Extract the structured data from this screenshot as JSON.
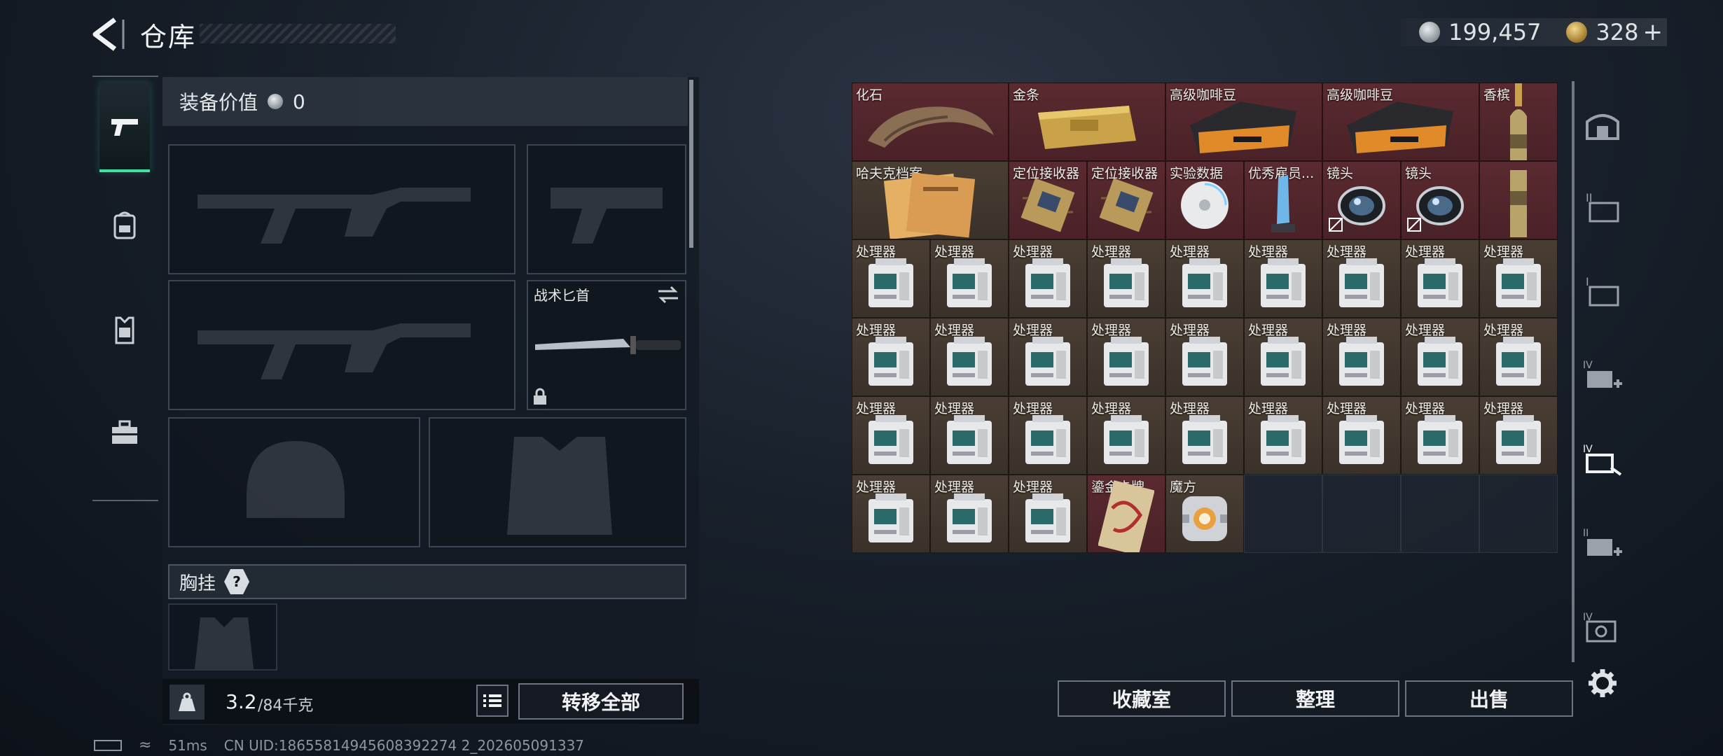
{
  "header": {
    "title": "仓库",
    "silver": "199,457",
    "gold": "328",
    "plus": "+"
  },
  "left_categories": [
    {
      "name": "weapon-icon"
    },
    {
      "name": "backpack-icon"
    },
    {
      "name": "armor-vest-icon"
    },
    {
      "name": "toolbox-icon"
    }
  ],
  "loadout": {
    "equip_value_label": "装备价值",
    "equip_value": "0",
    "knife_slot_label": "战术匕首",
    "chest_rig_label": "胸挂",
    "chest_rig_help": "?",
    "weight_value": "3.2",
    "weight_capacity": "/84千克",
    "transfer_all": "转移全部"
  },
  "storage": {
    "rows": [
      [
        {
          "label": "化石",
          "color": "red",
          "icon": "claw-fossil",
          "span": 2
        },
        {
          "label": "金条",
          "color": "red",
          "icon": "gold-bar",
          "span": 2
        },
        {
          "label": "高级咖啡豆",
          "color": "red",
          "icon": "coffee-bag",
          "span": 2
        },
        {
          "label": "高级咖啡豆",
          "color": "red",
          "icon": "coffee-bag",
          "span": 2
        },
        {
          "label": "香槟",
          "color": "red",
          "icon": "champagne",
          "span": 1
        }
      ],
      [
        {
          "label": "哈夫克档案",
          "color": "brown",
          "icon": "file-folder",
          "span": 2
        },
        {
          "label": "定位接收器",
          "color": "red",
          "icon": "receiver",
          "span": 1
        },
        {
          "label": "定位接收器",
          "color": "red",
          "icon": "receiver",
          "span": 1
        },
        {
          "label": "实验数据",
          "color": "red",
          "icon": "data-disc",
          "span": 1
        },
        {
          "label": "优秀雇员...",
          "color": "red",
          "icon": "crystal-award",
          "span": 1
        },
        {
          "label": "镜头",
          "color": "red",
          "icon": "lens",
          "span": 1,
          "locked": true
        },
        {
          "label": "镜头",
          "color": "red",
          "icon": "lens",
          "span": 1,
          "locked": true
        },
        {
          "label": "",
          "color": "red",
          "icon": "champagne-cont",
          "span": 1
        }
      ],
      [
        {
          "label": "处理器",
          "color": "brown",
          "icon": "processor",
          "span": 1
        },
        {
          "label": "处理器",
          "color": "brown",
          "icon": "processor",
          "span": 1
        },
        {
          "label": "处理器",
          "color": "brown",
          "icon": "processor",
          "span": 1
        },
        {
          "label": "处理器",
          "color": "brown",
          "icon": "processor",
          "span": 1
        },
        {
          "label": "处理器",
          "color": "brown",
          "icon": "processor",
          "span": 1
        },
        {
          "label": "处理器",
          "color": "brown",
          "icon": "processor",
          "span": 1
        },
        {
          "label": "处理器",
          "color": "brown",
          "icon": "processor",
          "span": 1
        },
        {
          "label": "处理器",
          "color": "brown",
          "icon": "processor",
          "span": 1
        },
        {
          "label": "处理器",
          "color": "brown",
          "icon": "processor",
          "span": 1
        }
      ],
      [
        {
          "label": "处理器",
          "color": "brown",
          "icon": "processor",
          "span": 1
        },
        {
          "label": "处理器",
          "color": "brown",
          "icon": "processor",
          "span": 1
        },
        {
          "label": "处理器",
          "color": "brown",
          "icon": "processor",
          "span": 1
        },
        {
          "label": "处理器",
          "color": "brown",
          "icon": "processor",
          "span": 1
        },
        {
          "label": "处理器",
          "color": "brown",
          "icon": "processor",
          "span": 1
        },
        {
          "label": "处理器",
          "color": "brown",
          "icon": "processor",
          "span": 1
        },
        {
          "label": "处理器",
          "color": "brown",
          "icon": "processor",
          "span": 1
        },
        {
          "label": "处理器",
          "color": "brown",
          "icon": "processor",
          "span": 1
        },
        {
          "label": "处理器",
          "color": "brown",
          "icon": "processor",
          "span": 1
        }
      ],
      [
        {
          "label": "处理器",
          "color": "brown",
          "icon": "processor",
          "span": 1
        },
        {
          "label": "处理器",
          "color": "brown",
          "icon": "processor",
          "span": 1
        },
        {
          "label": "处理器",
          "color": "brown",
          "icon": "processor",
          "span": 1
        },
        {
          "label": "处理器",
          "color": "brown",
          "icon": "processor",
          "span": 1
        },
        {
          "label": "处理器",
          "color": "brown",
          "icon": "processor",
          "span": 1
        },
        {
          "label": "处理器",
          "color": "brown",
          "icon": "processor",
          "span": 1
        },
        {
          "label": "处理器",
          "color": "brown",
          "icon": "processor",
          "span": 1
        },
        {
          "label": "处理器",
          "color": "brown",
          "icon": "processor",
          "span": 1
        },
        {
          "label": "处理器",
          "color": "brown",
          "icon": "processor",
          "span": 1
        }
      ],
      [
        {
          "label": "处理器",
          "color": "brown",
          "icon": "processor",
          "span": 1
        },
        {
          "label": "处理器",
          "color": "brown",
          "icon": "processor",
          "span": 1
        },
        {
          "label": "处理器",
          "color": "brown",
          "icon": "processor",
          "span": 1
        },
        {
          "label": "鎏金卡牌",
          "color": "red",
          "icon": "gilded-card",
          "span": 1
        },
        {
          "label": "魔方",
          "color": "brown",
          "icon": "cube",
          "span": 1
        },
        {
          "label": "",
          "color": "empty",
          "span": 1
        },
        {
          "label": "",
          "color": "empty",
          "span": 1
        },
        {
          "label": "",
          "color": "empty",
          "span": 1
        },
        {
          "label": "",
          "color": "empty",
          "span": 1
        }
      ]
    ]
  },
  "right_rail": [
    {
      "name": "stash-home-icon"
    },
    {
      "name": "container-ii-icon"
    },
    {
      "name": "container-i-icon"
    },
    {
      "name": "medkit-iv-icon"
    },
    {
      "name": "repair-iv-icon"
    },
    {
      "name": "medkit-ii-icon"
    },
    {
      "name": "case-iv-icon"
    },
    {
      "name": "settings-gear-icon"
    }
  ],
  "bottom_buttons": {
    "collection": "收藏室",
    "sort": "整理",
    "sell": "出售"
  },
  "status": {
    "ping": "51ms",
    "uid": "CN UID:18655814945608392274 2_202605091337"
  }
}
